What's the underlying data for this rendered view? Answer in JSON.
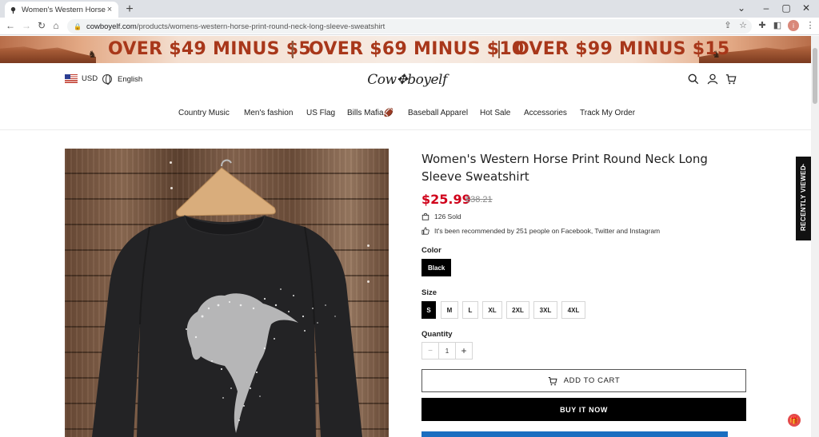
{
  "browser": {
    "tab_title": "Women's Western Horse Print R",
    "tab_close": "×",
    "new_tab": "+",
    "url_host": "cowboyelf.com",
    "url_path": "/products/womens-western-horse-print-round-neck-long-sleeve-sweatshirt",
    "profile_initial": "i"
  },
  "banner": {
    "promos": [
      "OVER $49 MINUS $5",
      "OVER $69 MINUS $10",
      "OVER $99 MINUS $15"
    ]
  },
  "header": {
    "currency": "USD",
    "language": "English",
    "logo_text": "Cow✥boyelf"
  },
  "nav": {
    "items": [
      "Country Music",
      "Men's fashion",
      "US Flag",
      "Bills Mafia🏈",
      "Baseball Apparel",
      "Hot Sale",
      "Accessories",
      "Track My Order"
    ]
  },
  "product": {
    "title": "Women's Western Horse Print Round Neck Long Sleeve Sweatshirt",
    "price": "$25.99",
    "old_price": "$38.21",
    "sold": "126 Sold",
    "recommended": "It's been recommended by 251 people on Facebook, Twitter and Instagram",
    "color_label": "Color",
    "colors": [
      "Black"
    ],
    "selected_color": "Black",
    "size_label": "Size",
    "sizes": [
      "S",
      "M",
      "L",
      "XL",
      "2XL",
      "3XL",
      "4XL"
    ],
    "selected_size": "S",
    "quantity_label": "Quantity",
    "quantity": "1",
    "qty_minus": "−",
    "qty_plus": "+",
    "add_to_cart": "ADD TO CART",
    "buy_now": "BUY IT NOW"
  },
  "sidebar": {
    "recently_viewed": "RECENTLY VIEWED"
  },
  "colors": {
    "price_red": "#d0021b",
    "promo_text": "#a8371a",
    "paypal_blue": "#1a6ec0"
  }
}
